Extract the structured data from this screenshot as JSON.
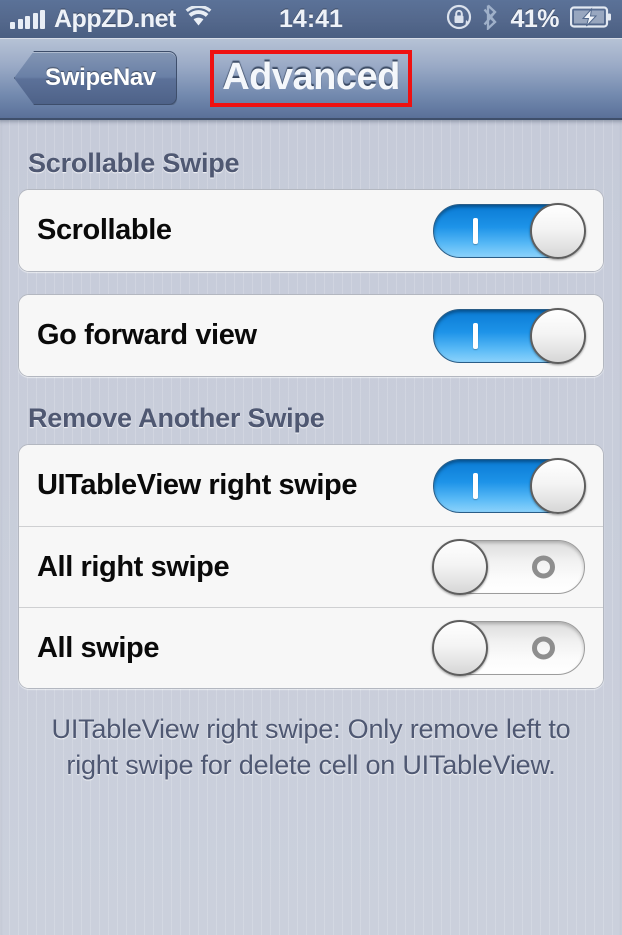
{
  "status_bar": {
    "carrier": "AppZD.net",
    "signal_bars": 5,
    "wifi_icon": "wifi-icon",
    "time": "14:41",
    "rotation_lock_icon": "rotation-lock-icon",
    "bluetooth_icon": "bluetooth-icon",
    "battery_percent": "41%",
    "battery_icon": "battery-charging-icon",
    "text_color": "#eef2f8",
    "background_color": "#54688c"
  },
  "nav_bar": {
    "back_button_label": "SwipeNav",
    "title": "Advanced",
    "title_highlight_color": "#ef1111"
  },
  "sections": [
    {
      "header": "Scrollable Swipe",
      "groups": [
        {
          "rows": [
            {
              "label": "Scrollable",
              "control": "switch",
              "state": "on",
              "mark": "|"
            }
          ]
        },
        {
          "rows": [
            {
              "label": "Go forward view",
              "control": "switch",
              "state": "on",
              "mark": "|"
            }
          ]
        }
      ]
    },
    {
      "header": "Remove Another Swipe",
      "groups": [
        {
          "rows": [
            {
              "label": "UITableView right swipe",
              "control": "switch",
              "state": "on",
              "mark": "|"
            },
            {
              "label": "All right swipe",
              "control": "switch",
              "state": "off",
              "mark": "O"
            },
            {
              "label": "All swipe",
              "control": "switch",
              "state": "off",
              "mark": "O"
            }
          ]
        }
      ],
      "footer": "UITableView right swipe: Only remove left to right swipe for delete cell on UITableView."
    }
  ],
  "colors": {
    "switch_on": "#1d93e8",
    "switch_off": "#f2f2f2",
    "section_header_text": "#4f5872",
    "page_background": "#c9cedb",
    "card_background": "#f7f7f7"
  }
}
